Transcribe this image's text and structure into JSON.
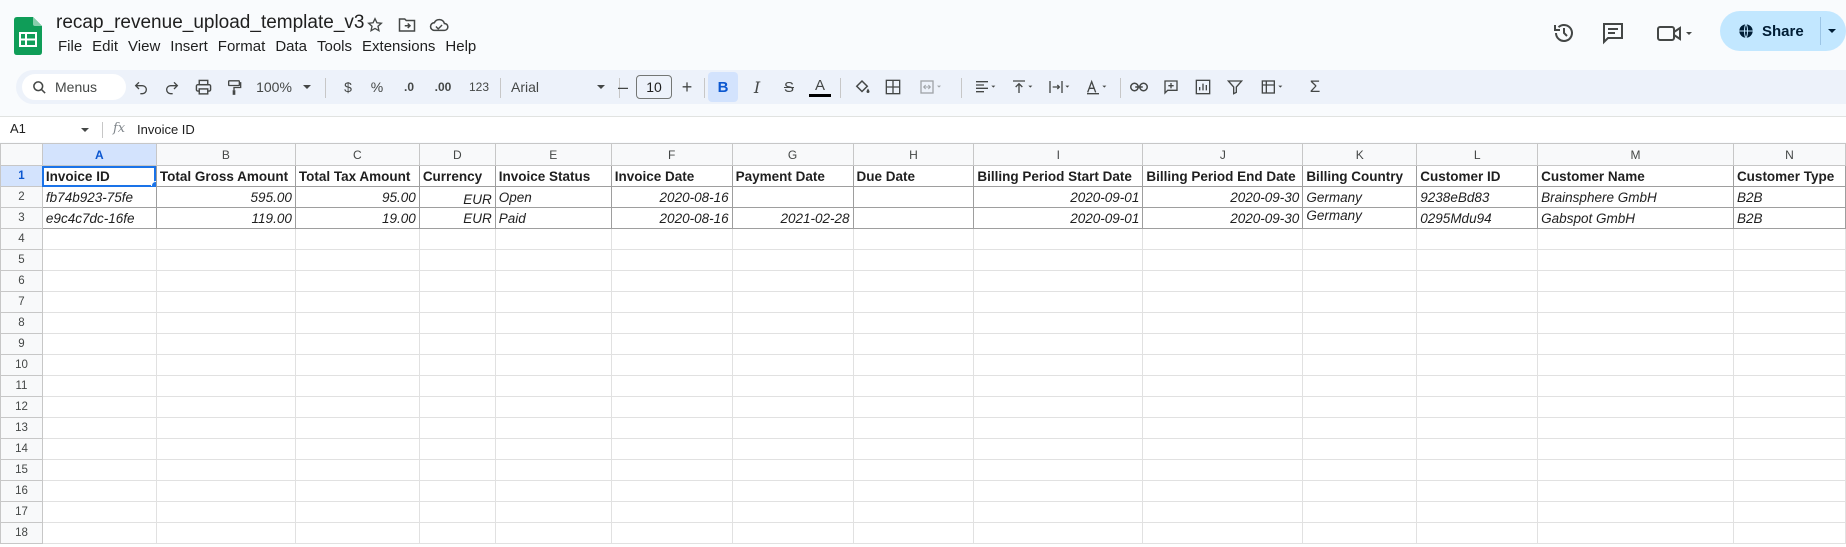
{
  "app": {
    "doc_title": "recap_revenue_upload_template_v3",
    "menu": [
      "File",
      "Edit",
      "View",
      "Insert",
      "Format",
      "Data",
      "Tools",
      "Extensions",
      "Help"
    ],
    "share_label": "Share"
  },
  "toolbar": {
    "search_label": "Menus",
    "zoom": "100%",
    "currency": "$",
    "percent": "%",
    "dec_decrease": ".0",
    "dec_increase": ".00",
    "number_format": "123",
    "font": "Arial",
    "font_size": "10",
    "bold": "B",
    "italic": "I",
    "strike": "S",
    "text_color": "A",
    "sum": "Σ"
  },
  "formula_bar": {
    "cell_ref": "A1",
    "fx": "fx",
    "value": "Invoice ID"
  },
  "sheet": {
    "columns": [
      "A",
      "B",
      "C",
      "D",
      "E",
      "F",
      "G",
      "H",
      "I",
      "J",
      "K",
      "L",
      "M",
      "N"
    ],
    "headers": [
      "Invoice ID",
      "Total Gross Amount",
      "Total Tax Amount",
      "Currency",
      "Invoice Status",
      "Invoice Date",
      "Payment Date",
      "Due Date",
      "Billing Period Start Date",
      "Billing Period End Date",
      "Billing Country",
      "Customer ID",
      "Customer Name",
      "Customer Type"
    ],
    "rows": [
      [
        "fb74b923-75fe",
        "595.00",
        "95.00",
        "EUR",
        "Open",
        "2020-08-16",
        "",
        "",
        "2020-09-01",
        "2020-09-30",
        "Germany",
        "9238eBd83",
        "Brainsphere GmbH",
        "B2B"
      ],
      [
        "e9c4c7dc-16fe",
        "119.00",
        "19.00",
        "EUR",
        "Paid",
        "2020-08-16",
        "2021-02-28",
        "",
        "2020-09-01",
        "2020-09-30",
        "Germany",
        "0295Mdu94",
        "Gabspot GmbH",
        "B2B"
      ]
    ],
    "row_numbers": [
      "1",
      "2",
      "3",
      "4",
      "5",
      "6",
      "7",
      "8",
      "9",
      "10",
      "11",
      "12",
      "13",
      "14",
      "15",
      "16",
      "17",
      "18"
    ],
    "selected_cell": "A1"
  }
}
